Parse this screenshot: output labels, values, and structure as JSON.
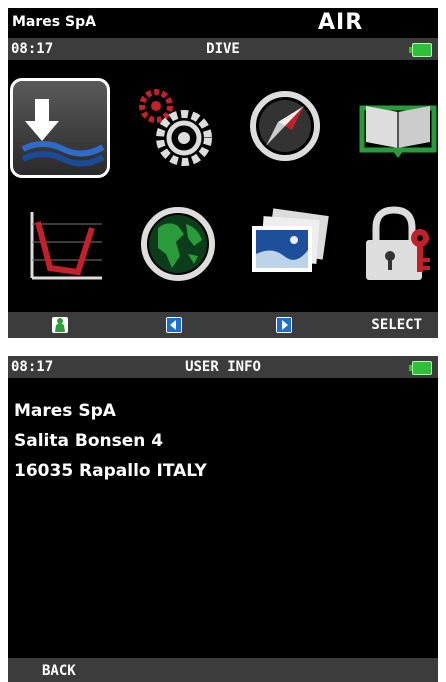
{
  "screen1": {
    "brand": "Mares SpA",
    "mode": "AIR",
    "time": "08:17",
    "title": "DIVE",
    "icons": [
      {
        "name": "download-dive-icon",
        "selected": true
      },
      {
        "name": "settings-gears-icon",
        "selected": false
      },
      {
        "name": "compass-icon",
        "selected": false
      },
      {
        "name": "logbook-icon",
        "selected": false
      },
      {
        "name": "dive-profile-chart-icon",
        "selected": false
      },
      {
        "name": "globe-icon",
        "selected": false
      },
      {
        "name": "photos-icon",
        "selected": false
      },
      {
        "name": "lock-key-icon",
        "selected": false
      }
    ],
    "softkeys": {
      "k1_icon": "diver-icon",
      "k2_icon": "left-arrow-icon",
      "k3_icon": "right-arrow-icon",
      "select": "SELECT"
    }
  },
  "screen2": {
    "time": "08:17",
    "title": "USER INFO",
    "lines": [
      "Mares SpA",
      "Salita Bonsen 4",
      "16035 Rapallo ITALY"
    ],
    "back": "BACK"
  },
  "colors": {
    "battery": "#2fbf3a",
    "softkey_green": "#2e9e3a",
    "softkey_blue": "#1a6fd1",
    "water_blue": "#1e4f9a",
    "logbook_green": "#2a9b3a",
    "gear_red": "#c0212a"
  }
}
